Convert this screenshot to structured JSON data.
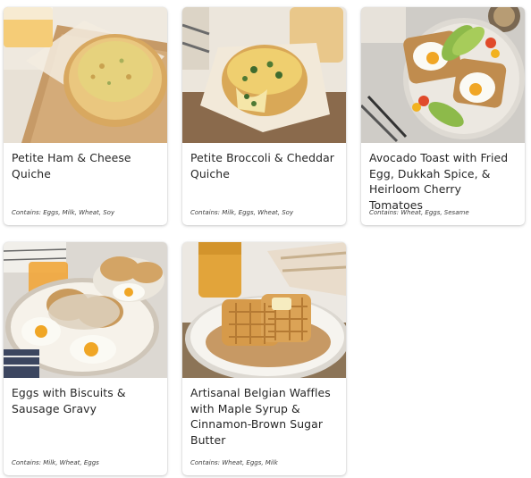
{
  "cards": [
    {
      "title": "Petite Ham & Cheese Quiche",
      "contains": "Contains: Eggs, Milk, Wheat, Soy",
      "image": "ham-cheese-quiche-photo"
    },
    {
      "title": "Petite Broccoli & Cheddar Quiche",
      "contains": "Contains: Milk, Eggs, Wheat, Soy",
      "image": "broccoli-cheddar-quiche-photo"
    },
    {
      "title": "Avocado Toast with Fried Egg, Dukkah Spice, & Heirloom Cherry Tomatoes",
      "contains": "Contains: Wheat, Eggs, Sesame",
      "image": "avocado-toast-photo"
    },
    {
      "title": "Eggs with Biscuits & Sausage Gravy",
      "contains": "Contains: Milk, Wheat, Eggs",
      "image": "eggs-biscuits-gravy-photo"
    },
    {
      "title": "Artisanal Belgian Waffles with Maple Syrup & Cinnamon-Brown Sugar Butter",
      "contains": "Contains: Wheat, Eggs, Milk",
      "image": "belgian-waffles-photo"
    }
  ]
}
